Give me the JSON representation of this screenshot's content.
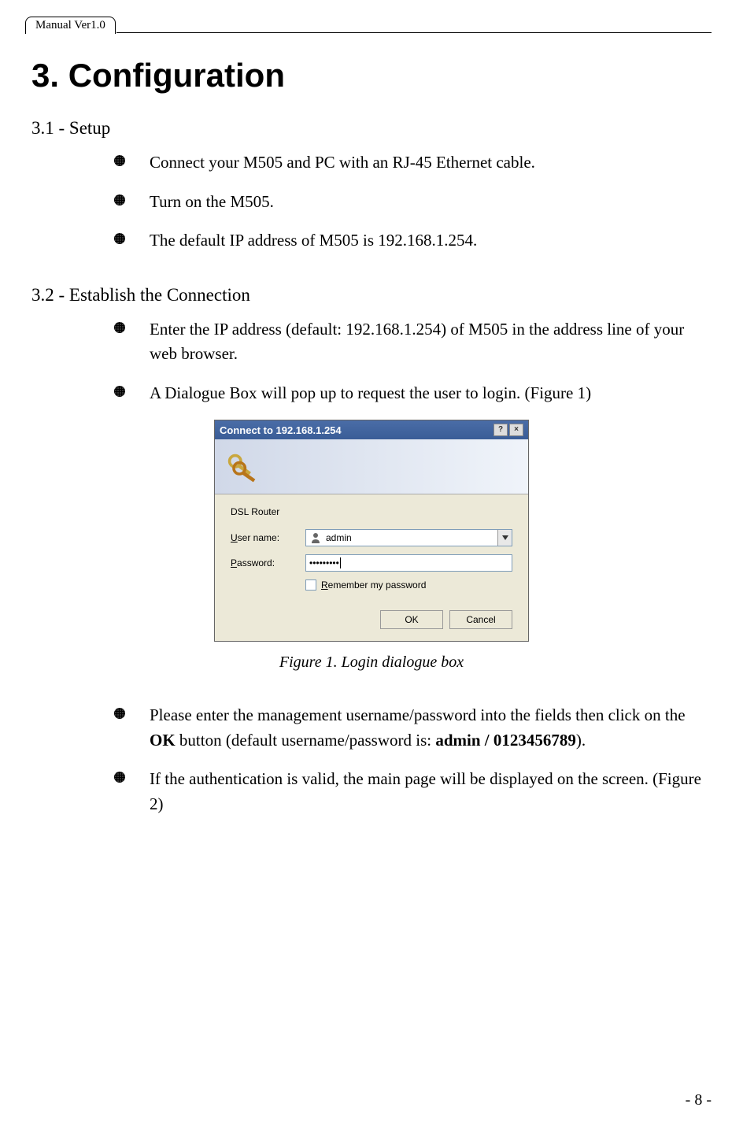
{
  "header": {
    "version": "Manual Ver1.0"
  },
  "title": "3. Configuration",
  "sections": {
    "setup": {
      "heading": "3.1 - Setup",
      "items": [
        "Connect your M505 and PC with an RJ-45 Ethernet cable.",
        "Turn on the M505.",
        "The default IP address of M505 is 192.168.1.254."
      ]
    },
    "establish": {
      "heading": "3.2 - Establish the Connection",
      "items_top": [
        "Enter the IP address (default: 192.168.1.254) of M505 in the address line of your web browser.",
        "A Dialogue Box will pop up to request the user to login. (Figure 1)"
      ],
      "items_bottom_1_pre": "Please enter the management username/password into the fields then click on the ",
      "items_bottom_1_bold1": "OK",
      "items_bottom_1_mid": " button (default username/password is: ",
      "items_bottom_1_bold2": "admin / 0123456789",
      "items_bottom_1_post": ").",
      "items_bottom_2": "If the authentication is valid, the main page will be displayed on the screen. (Figure 2)"
    }
  },
  "dialog": {
    "title": "Connect to 192.168.1.254",
    "server_label": "DSL Router",
    "username_label": "User name:",
    "username_value": "admin",
    "password_label": "Password:",
    "password_value": "•••••••••",
    "remember_label": "Remember my password",
    "ok_button": "OK",
    "cancel_button": "Cancel"
  },
  "figure_caption": "Figure 1. Login dialogue box",
  "page_number": "- 8 -"
}
